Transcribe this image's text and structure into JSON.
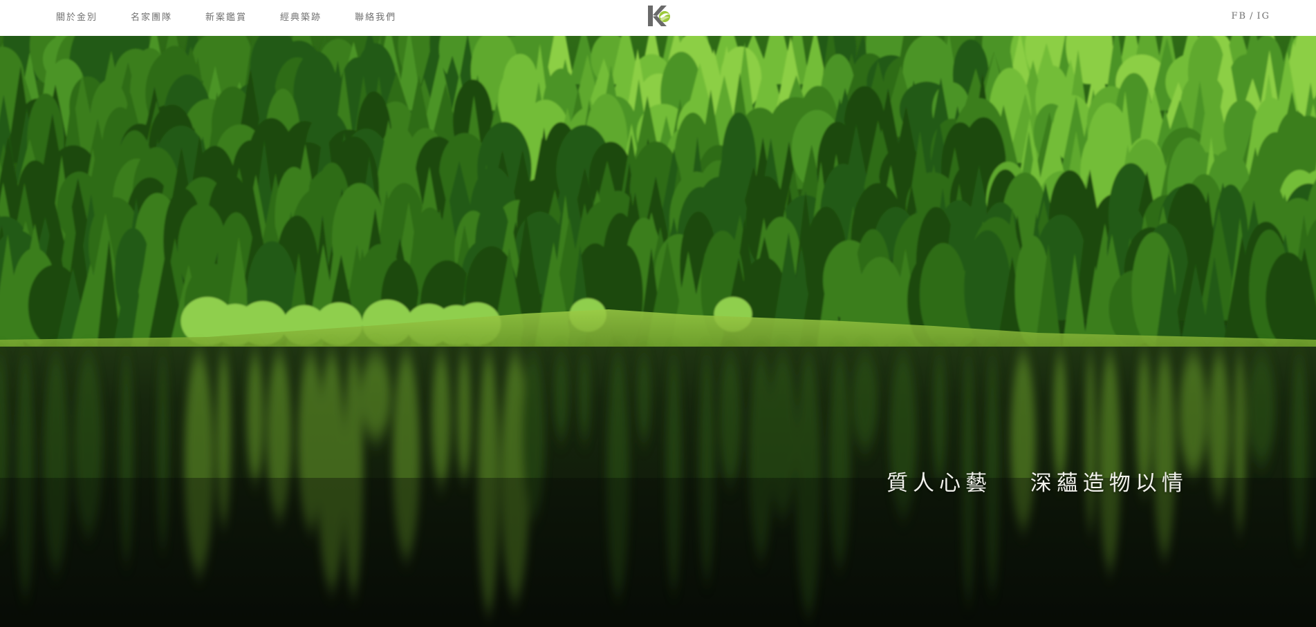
{
  "header": {
    "nav": [
      {
        "label": "關於金別"
      },
      {
        "label": "名家團隊"
      },
      {
        "label": "新案鑑賞"
      },
      {
        "label": "經典築跡"
      },
      {
        "label": "聯絡我們"
      }
    ],
    "logo_icon": "kc-leaf-logo",
    "social": {
      "fb": "FB",
      "separator": "/",
      "ig": "IG"
    }
  },
  "hero": {
    "tagline_1": "質人心藝",
    "tagline_2": "深蘊造物以情",
    "colors": {
      "forest_dark": "#14300c",
      "forest_mid": "#2f6a1a",
      "forest_light": "#6fbf3a",
      "meadow": "#8fc23f",
      "water": "#0c140a"
    }
  }
}
